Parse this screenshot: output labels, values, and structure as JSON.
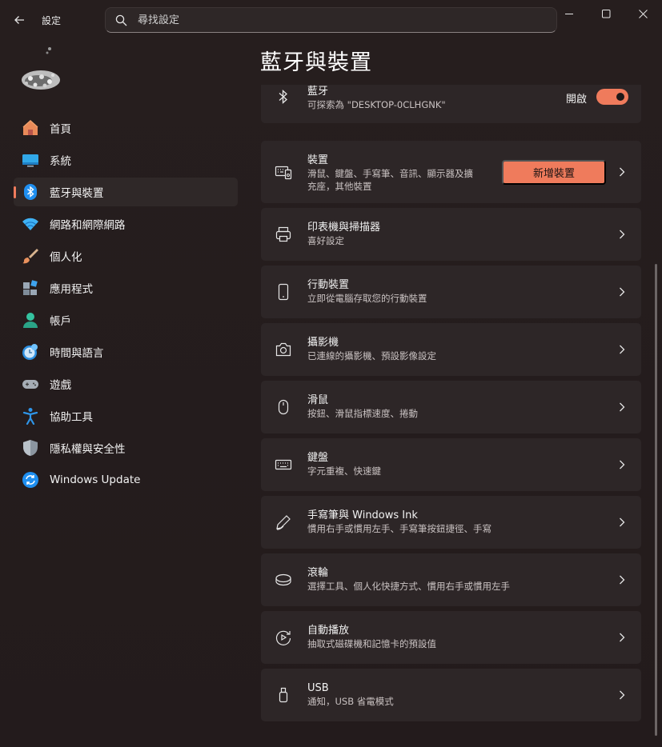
{
  "window": {
    "app_title": "設定",
    "search_placeholder": "尋找設定"
  },
  "nav": [
    {
      "label": "首頁",
      "icon": "home-icon"
    },
    {
      "label": "系統",
      "icon": "system-icon"
    },
    {
      "label": "藍牙與裝置",
      "icon": "bluetooth-icon",
      "active": true
    },
    {
      "label": "網路和網際網路",
      "icon": "wifi-icon"
    },
    {
      "label": "個人化",
      "icon": "brush-icon"
    },
    {
      "label": "應用程式",
      "icon": "apps-icon"
    },
    {
      "label": "帳戶",
      "icon": "account-icon"
    },
    {
      "label": "時間與語言",
      "icon": "time-language-icon"
    },
    {
      "label": "遊戲",
      "icon": "gamepad-icon"
    },
    {
      "label": "協助工具",
      "icon": "accessibility-icon"
    },
    {
      "label": "隱私權與安全性",
      "icon": "shield-icon"
    },
    {
      "label": "Windows Update",
      "icon": "update-icon"
    }
  ],
  "page_title": "藍牙與裝置",
  "bluetooth": {
    "title": "藍牙",
    "subtitle": "可探索為 \"DESKTOP-0CLHGNK\"",
    "toggle_label": "開啟",
    "toggle_on": true
  },
  "devices": {
    "title": "裝置",
    "subtitle_line1": "滑鼠、鍵盤、手寫筆、音訊、顯示器及擴",
    "subtitle_line2": "充座，其他裝置",
    "add_button": "新增裝置"
  },
  "cards": [
    {
      "title": "印表機與掃描器",
      "subtitle": "喜好設定",
      "icon": "printer-icon"
    },
    {
      "title": "行動裝置",
      "subtitle": "立即從電腦存取您的行動裝置",
      "icon": "phone-icon"
    },
    {
      "title": "攝影機",
      "subtitle": "已連線的攝影機、預設影像設定",
      "icon": "camera-icon"
    },
    {
      "title": "滑鼠",
      "subtitle": "按鈕、滑鼠指標速度、捲動",
      "icon": "mouse-icon"
    },
    {
      "title": "鍵盤",
      "subtitle": "字元重複、快速鍵",
      "icon": "keyboard-icon"
    },
    {
      "title": "手寫筆與 Windows Ink",
      "subtitle": "慣用右手或慣用左手、手寫筆按鈕捷徑、手寫",
      "icon": "pen-icon"
    },
    {
      "title": "滾輪",
      "subtitle": "選擇工具、個人化快捷方式、慣用右手或慣用左手",
      "icon": "wheel-icon"
    },
    {
      "title": "自動播放",
      "subtitle": "抽取式磁碟機和記憶卡的預設值",
      "icon": "autoplay-icon"
    },
    {
      "title": "USB",
      "subtitle": "通知，USB 省電模式",
      "icon": "usb-icon"
    }
  ],
  "colors": {
    "accent": "#ef7b5c",
    "background": "#241d1d",
    "card": "#2d2627"
  }
}
